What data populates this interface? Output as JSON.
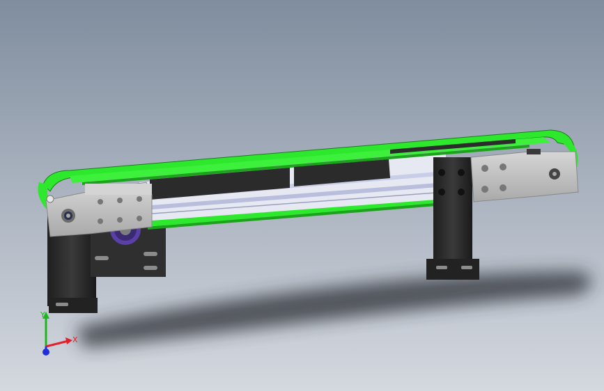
{
  "viewport": {
    "background_top": "#7f8d9e",
    "background_bottom": "#d4d8df"
  },
  "model": {
    "belt_color": "#2ee82e",
    "belt_dark": "#1aa41a",
    "frame_color": "#c9c9c9",
    "plate_color": "#bfbfbf",
    "leg_color": "#2d2d2d",
    "slot_color": "#2b2b2b",
    "rail_color": "#c8cde8",
    "sprocket_color": "#5a3fa8"
  },
  "triad": {
    "x_label": "X",
    "y_label": "Y",
    "x_color": "#e0202a",
    "y_color": "#1fb51f",
    "z_color": "#2030d8"
  }
}
